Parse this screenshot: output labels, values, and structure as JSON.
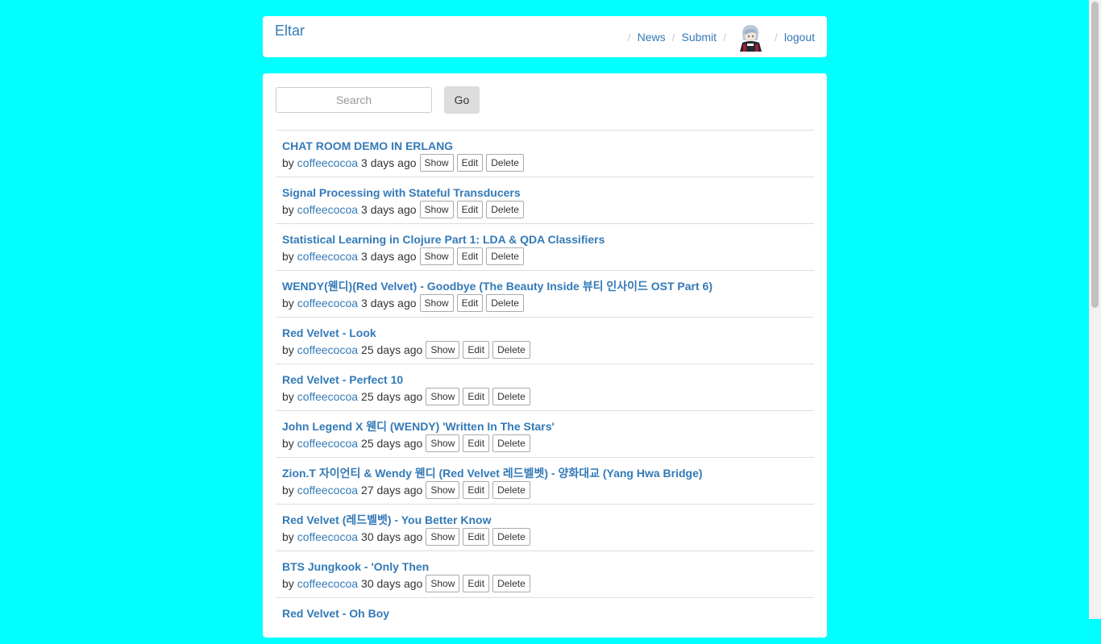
{
  "navbar": {
    "brand": "Eltar",
    "separator": "/",
    "links": {
      "news": "News",
      "submit": "Submit",
      "logout": "logout"
    }
  },
  "search": {
    "placeholder": "Search",
    "button": "Go"
  },
  "labels": {
    "by": "by",
    "show": "Show",
    "edit": "Edit",
    "delete": "Delete"
  },
  "posts": [
    {
      "title": "CHAT ROOM DEMO IN ERLANG",
      "author": "coffeecocoa",
      "age": "3 days ago"
    },
    {
      "title": "Signal Processing with Stateful Transducers",
      "author": "coffeecocoa",
      "age": "3 days ago"
    },
    {
      "title": "Statistical Learning in Clojure Part 1: LDA & QDA Classifiers",
      "author": "coffeecocoa",
      "age": "3 days ago"
    },
    {
      "title": "WENDY(웬디)(Red Velvet) - Goodbye (The Beauty Inside 뷰티 인사이드 OST Part 6)",
      "author": "coffeecocoa",
      "age": "3 days ago"
    },
    {
      "title": "Red Velvet - Look",
      "author": "coffeecocoa",
      "age": "25 days ago"
    },
    {
      "title": "Red Velvet - Perfect 10",
      "author": "coffeecocoa",
      "age": "25 days ago"
    },
    {
      "title": "John Legend X 웬디 (WENDY) 'Written In The Stars'",
      "author": "coffeecocoa",
      "age": "25 days ago"
    },
    {
      "title": "Zion.T 자이언티 & Wendy 웬디 (Red Velvet 레드벨벳) - 양화대교 (Yang Hwa Bridge)",
      "author": "coffeecocoa",
      "age": "27 days ago"
    },
    {
      "title": "Red Velvet (레드벨벳) - You Better Know",
      "author": "coffeecocoa",
      "age": "30 days ago"
    },
    {
      "title": "BTS Jungkook - 'Only Then",
      "author": "coffeecocoa",
      "age": "30 days ago"
    },
    {
      "title": "Red Velvet - Oh Boy",
      "author": "coffeecocoa",
      "age": ""
    }
  ]
}
